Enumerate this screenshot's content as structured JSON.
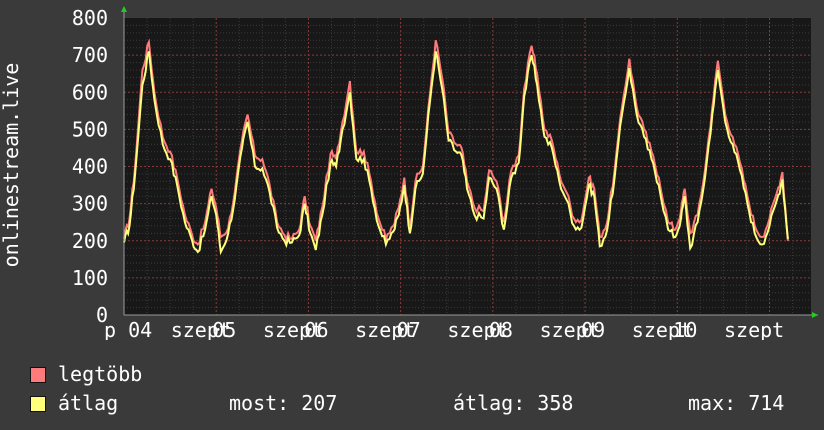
{
  "colors": {
    "background": "#3a3a3a",
    "plot_background": "#181818",
    "grid": "#a05050",
    "max_series": "#ff7b7b",
    "avg_series": "#ffff7b",
    "axis_arrow": "#22cc22",
    "text": "#ffffff"
  },
  "chart_data": {
    "type": "line",
    "ylabel": "onlinestream.live",
    "ylim": [
      0,
      800
    ],
    "yticks": [
      0,
      100,
      200,
      300,
      400,
      500,
      600,
      700,
      800
    ],
    "xlim": [
      0,
      7.45
    ],
    "xtick_labels": [
      {
        "x": 0.0,
        "text": "p 04"
      },
      {
        "x": 0.55,
        "text": "szept"
      },
      {
        "x": 1.0,
        "text": "05"
      },
      {
        "x": 1.55,
        "text": "szept"
      },
      {
        "x": 2.0,
        "text": "06"
      },
      {
        "x": 2.55,
        "text": "szept"
      },
      {
        "x": 3.0,
        "text": "07"
      },
      {
        "x": 3.55,
        "text": "szept"
      },
      {
        "x": 4.0,
        "text": "08"
      },
      {
        "x": 4.55,
        "text": "szept"
      },
      {
        "x": 5.0,
        "text": "09"
      },
      {
        "x": 5.55,
        "text": "szept"
      },
      {
        "x": 6.0,
        "text": "10"
      },
      {
        "x": 6.55,
        "text": "szept"
      }
    ],
    "grid": true,
    "series_max_anchors": [
      [
        0.0,
        205
      ],
      [
        0.06,
        260
      ],
      [
        0.12,
        400
      ],
      [
        0.2,
        660
      ],
      [
        0.27,
        735
      ],
      [
        0.33,
        600
      ],
      [
        0.42,
        480
      ],
      [
        0.5,
        440
      ],
      [
        0.58,
        365
      ],
      [
        0.66,
        270
      ],
      [
        0.74,
        215
      ],
      [
        0.8,
        190
      ],
      [
        0.88,
        250
      ],
      [
        0.95,
        340
      ],
      [
        1.0,
        290
      ],
      [
        1.05,
        210
      ],
      [
        1.13,
        235
      ],
      [
        1.2,
        330
      ],
      [
        1.28,
        470
      ],
      [
        1.34,
        540
      ],
      [
        1.42,
        430
      ],
      [
        1.5,
        420
      ],
      [
        1.58,
        350
      ],
      [
        1.66,
        250
      ],
      [
        1.74,
        215
      ],
      [
        1.82,
        205
      ],
      [
        1.9,
        230
      ],
      [
        1.96,
        320
      ],
      [
        2.02,
        240
      ],
      [
        2.08,
        200
      ],
      [
        2.15,
        290
      ],
      [
        2.24,
        435
      ],
      [
        2.3,
        420
      ],
      [
        2.37,
        520
      ],
      [
        2.45,
        630
      ],
      [
        2.52,
        440
      ],
      [
        2.6,
        440
      ],
      [
        2.68,
        360
      ],
      [
        2.76,
        260
      ],
      [
        2.84,
        205
      ],
      [
        2.92,
        240
      ],
      [
        2.98,
        290
      ],
      [
        3.04,
        370
      ],
      [
        3.1,
        240
      ],
      [
        3.16,
        360
      ],
      [
        3.24,
        400
      ],
      [
        3.32,
        600
      ],
      [
        3.38,
        740
      ],
      [
        3.45,
        640
      ],
      [
        3.52,
        490
      ],
      [
        3.6,
        460
      ],
      [
        3.66,
        450
      ],
      [
        3.72,
        360
      ],
      [
        3.8,
        290
      ],
      [
        3.9,
        280
      ],
      [
        3.96,
        390
      ],
      [
        4.04,
        360
      ],
      [
        4.12,
        250
      ],
      [
        4.2,
        390
      ],
      [
        4.28,
        430
      ],
      [
        4.34,
        610
      ],
      [
        4.42,
        725
      ],
      [
        4.48,
        650
      ],
      [
        4.56,
        500
      ],
      [
        4.64,
        470
      ],
      [
        4.72,
        380
      ],
      [
        4.8,
        330
      ],
      [
        4.88,
        260
      ],
      [
        4.96,
        255
      ],
      [
        5.04,
        370
      ],
      [
        5.1,
        340
      ],
      [
        5.16,
        210
      ],
      [
        5.24,
        250
      ],
      [
        5.32,
        390
      ],
      [
        5.4,
        560
      ],
      [
        5.48,
        690
      ],
      [
        5.56,
        560
      ],
      [
        5.64,
        500
      ],
      [
        5.72,
        440
      ],
      [
        5.8,
        370
      ],
      [
        5.9,
        250
      ],
      [
        5.98,
        230
      ],
      [
        6.04,
        280
      ],
      [
        6.08,
        340
      ],
      [
        6.14,
        220
      ],
      [
        6.22,
        270
      ],
      [
        6.3,
        390
      ],
      [
        6.38,
        560
      ],
      [
        6.44,
        685
      ],
      [
        6.52,
        540
      ],
      [
        6.6,
        480
      ],
      [
        6.68,
        410
      ],
      [
        6.76,
        320
      ],
      [
        6.84,
        240
      ],
      [
        6.92,
        210
      ],
      [
        7.0,
        260
      ],
      [
        7.08,
        330
      ],
      [
        7.14,
        385
      ],
      [
        7.2,
        200
      ]
    ],
    "series_avg_anchors": [
      [
        0.0,
        195
      ],
      [
        0.06,
        240
      ],
      [
        0.12,
        380
      ],
      [
        0.2,
        620
      ],
      [
        0.27,
        710
      ],
      [
        0.33,
        580
      ],
      [
        0.42,
        460
      ],
      [
        0.5,
        420
      ],
      [
        0.58,
        345
      ],
      [
        0.66,
        250
      ],
      [
        0.74,
        200
      ],
      [
        0.8,
        170
      ],
      [
        0.88,
        230
      ],
      [
        0.95,
        320
      ],
      [
        1.0,
        270
      ],
      [
        1.05,
        170
      ],
      [
        1.13,
        220
      ],
      [
        1.2,
        310
      ],
      [
        1.28,
        450
      ],
      [
        1.34,
        520
      ],
      [
        1.42,
        400
      ],
      [
        1.5,
        395
      ],
      [
        1.58,
        330
      ],
      [
        1.66,
        235
      ],
      [
        1.74,
        200
      ],
      [
        1.82,
        195
      ],
      [
        1.9,
        215
      ],
      [
        1.96,
        300
      ],
      [
        2.02,
        220
      ],
      [
        2.08,
        175
      ],
      [
        2.15,
        270
      ],
      [
        2.24,
        410
      ],
      [
        2.3,
        400
      ],
      [
        2.37,
        500
      ],
      [
        2.45,
        600
      ],
      [
        2.52,
        420
      ],
      [
        2.6,
        420
      ],
      [
        2.68,
        340
      ],
      [
        2.76,
        240
      ],
      [
        2.84,
        190
      ],
      [
        2.92,
        225
      ],
      [
        2.98,
        270
      ],
      [
        3.04,
        350
      ],
      [
        3.1,
        220
      ],
      [
        3.16,
        340
      ],
      [
        3.24,
        380
      ],
      [
        3.32,
        580
      ],
      [
        3.38,
        710
      ],
      [
        3.45,
        610
      ],
      [
        3.52,
        470
      ],
      [
        3.6,
        440
      ],
      [
        3.66,
        430
      ],
      [
        3.72,
        340
      ],
      [
        3.8,
        270
      ],
      [
        3.9,
        260
      ],
      [
        3.96,
        370
      ],
      [
        4.04,
        340
      ],
      [
        4.12,
        230
      ],
      [
        4.2,
        370
      ],
      [
        4.28,
        410
      ],
      [
        4.34,
        590
      ],
      [
        4.42,
        700
      ],
      [
        4.48,
        620
      ],
      [
        4.56,
        480
      ],
      [
        4.64,
        450
      ],
      [
        4.72,
        360
      ],
      [
        4.8,
        310
      ],
      [
        4.88,
        240
      ],
      [
        4.96,
        235
      ],
      [
        5.04,
        350
      ],
      [
        5.1,
        320
      ],
      [
        5.16,
        185
      ],
      [
        5.24,
        230
      ],
      [
        5.32,
        370
      ],
      [
        5.4,
        540
      ],
      [
        5.48,
        665
      ],
      [
        5.56,
        540
      ],
      [
        5.64,
        480
      ],
      [
        5.72,
        420
      ],
      [
        5.8,
        350
      ],
      [
        5.9,
        230
      ],
      [
        5.98,
        210
      ],
      [
        6.04,
        260
      ],
      [
        6.08,
        320
      ],
      [
        6.14,
        180
      ],
      [
        6.22,
        250
      ],
      [
        6.3,
        370
      ],
      [
        6.38,
        540
      ],
      [
        6.44,
        660
      ],
      [
        6.52,
        520
      ],
      [
        6.6,
        460
      ],
      [
        6.68,
        390
      ],
      [
        6.76,
        300
      ],
      [
        6.84,
        220
      ],
      [
        6.92,
        190
      ],
      [
        7.0,
        240
      ],
      [
        7.08,
        310
      ],
      [
        7.14,
        365
      ],
      [
        7.2,
        205
      ]
    ]
  },
  "legend": {
    "max_label": "legtöbb",
    "avg_label": "átlag",
    "now_key": "most:",
    "now_value": "207",
    "avg_key": "átlag:",
    "avg_value": "358",
    "max_key": "max:",
    "max_value": "714"
  }
}
